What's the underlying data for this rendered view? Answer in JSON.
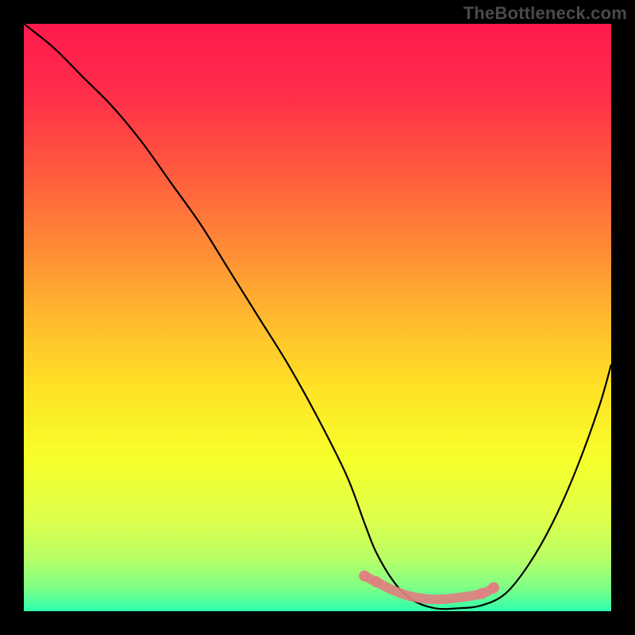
{
  "watermark": "TheBottleneck.com",
  "chart_data": {
    "type": "line",
    "title": "",
    "xlabel": "",
    "ylabel": "",
    "xlim": [
      0,
      100
    ],
    "ylim": [
      0,
      100
    ],
    "series": [
      {
        "name": "bottleneck-curve",
        "x": [
          0,
          5,
          10,
          15,
          20,
          25,
          30,
          35,
          40,
          45,
          50,
          55,
          58,
          60,
          63,
          66,
          70,
          74,
          78,
          82,
          86,
          90,
          94,
          98,
          100
        ],
        "y": [
          100,
          96,
          91,
          86,
          80,
          73,
          66,
          58,
          50,
          42,
          33,
          23,
          15,
          10,
          5,
          2,
          0.5,
          0.5,
          1,
          3,
          8,
          15,
          24,
          35,
          42
        ]
      }
    ],
    "highlight_band": {
      "name": "optimal-range",
      "x": [
        58,
        60,
        63,
        66,
        70,
        74,
        78,
        80
      ],
      "y": [
        6,
        5,
        3.5,
        2.5,
        2,
        2.3,
        3,
        4
      ]
    },
    "gradient_stops": [
      {
        "offset": 0.0,
        "color": "#ff1a4d"
      },
      {
        "offset": 0.12,
        "color": "#ff2d4a"
      },
      {
        "offset": 0.25,
        "color": "#ff5a3f"
      },
      {
        "offset": 0.38,
        "color": "#ff8a36"
      },
      {
        "offset": 0.5,
        "color": "#ffb92e"
      },
      {
        "offset": 0.62,
        "color": "#ffe226"
      },
      {
        "offset": 0.74,
        "color": "#f6ff2a"
      },
      {
        "offset": 0.84,
        "color": "#dfff4a"
      },
      {
        "offset": 0.91,
        "color": "#b8ff66"
      },
      {
        "offset": 0.96,
        "color": "#7dff86"
      },
      {
        "offset": 1.0,
        "color": "#2fffad"
      }
    ],
    "colors": {
      "curve": "#000000",
      "highlight": "#e08080"
    }
  }
}
